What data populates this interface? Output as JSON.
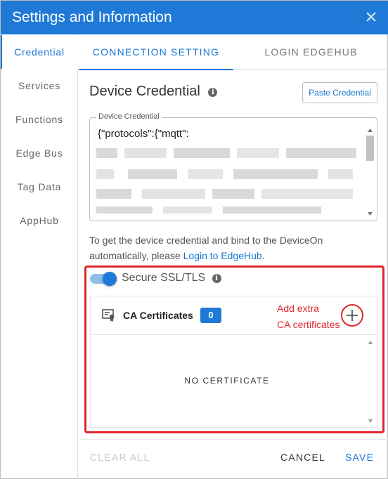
{
  "dialog": {
    "title": "Settings and Information"
  },
  "sidebar": {
    "items": [
      {
        "label": "Credential",
        "active": true
      },
      {
        "label": "Services"
      },
      {
        "label": "Functions"
      },
      {
        "label": "Edge Bus"
      },
      {
        "label": "Tag Data"
      },
      {
        "label": "AppHub"
      }
    ]
  },
  "tabs": [
    {
      "label": "CONNECTION SETTING",
      "active": true
    },
    {
      "label": "LOGIN EDGEHUB"
    }
  ],
  "credential": {
    "title": "Device Credential",
    "paste_label": "Paste Credential",
    "field_label": "Device Credential",
    "value_visible": "{\"protocols\":{\"mqtt\":"
  },
  "help": {
    "text": "To get the device credential and bind to the DeviceOn automatically, please ",
    "link": "Login to EdgeHub",
    "suffix": "."
  },
  "ssl": {
    "label": "Secure SSL/TLS",
    "enabled": true
  },
  "ca": {
    "title": "CA Certificates",
    "count": "0",
    "empty_text": "NO CERTIFICATE",
    "annotation_line1": "Add extra",
    "annotation_line2": "CA certificates"
  },
  "footer": {
    "clear_all": "CLEAR ALL",
    "cancel": "CANCEL",
    "save": "SAVE"
  },
  "colors": {
    "primary": "#1e7ad6",
    "annotation_red": "#e0262c",
    "disabled": "#bdbdbd"
  }
}
